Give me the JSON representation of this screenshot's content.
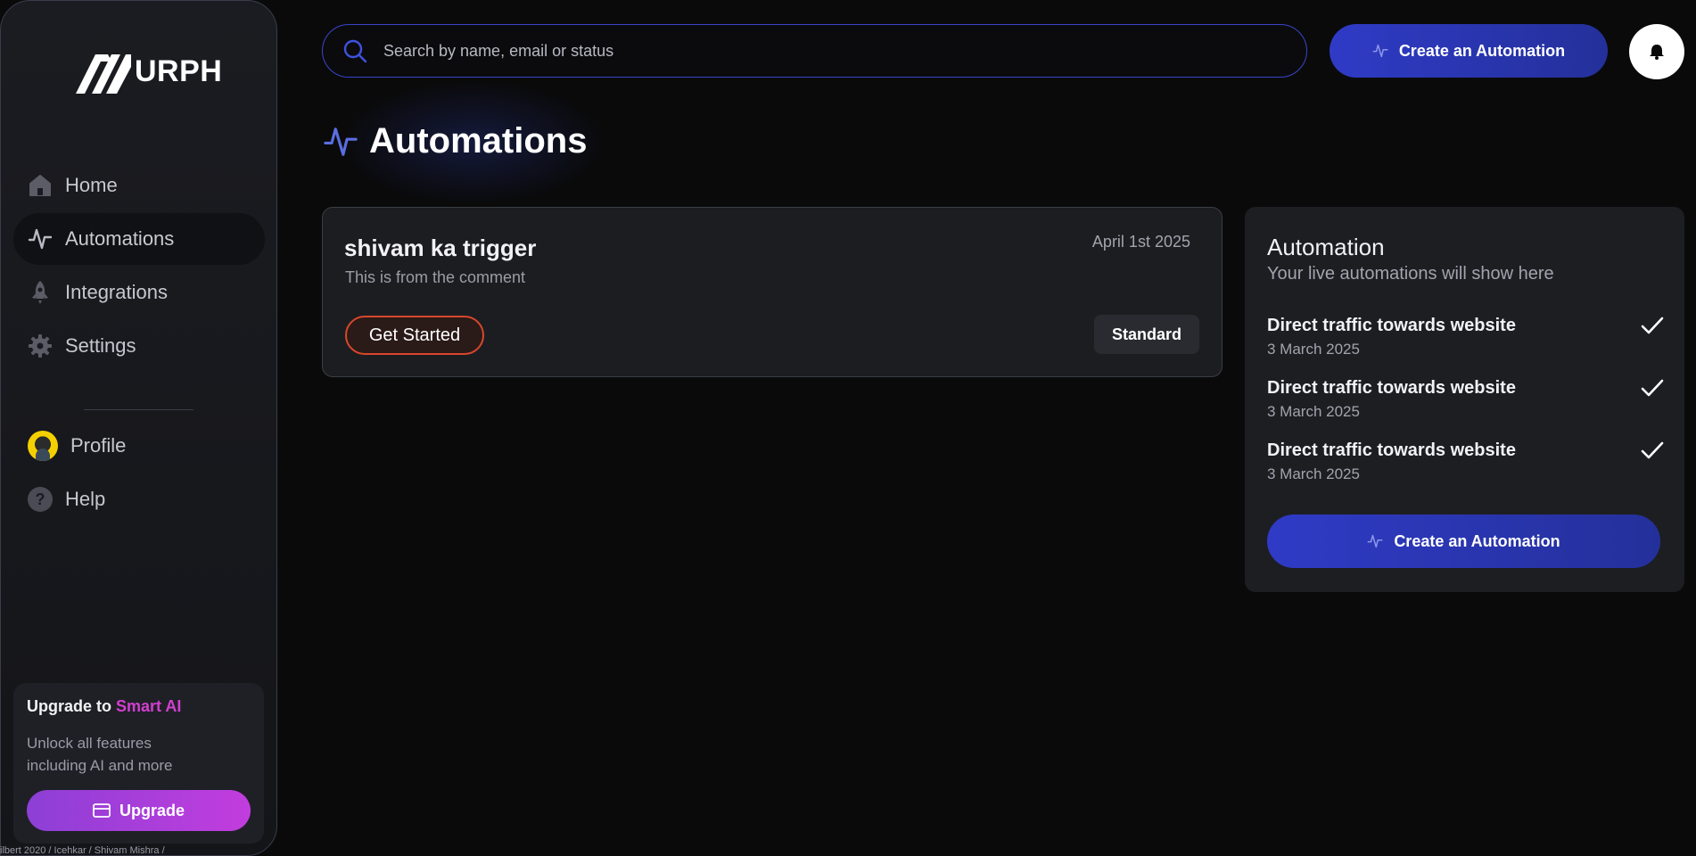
{
  "sidebar": {
    "logo_text": "URPH",
    "nav": [
      {
        "label": "Home",
        "icon": "home-icon"
      },
      {
        "label": "Automations",
        "icon": "pulse-icon"
      },
      {
        "label": "Integrations",
        "icon": "rocket-icon"
      },
      {
        "label": "Settings",
        "icon": "gear-icon"
      }
    ],
    "secondary_nav": [
      {
        "label": "Profile",
        "icon": "avatar"
      },
      {
        "label": "Help",
        "icon": "help-icon"
      }
    ],
    "upgrade": {
      "title_prefix": "Upgrade to ",
      "title_accent": "Smart AI",
      "description": "Unlock all features including AI and more",
      "button_label": "Upgrade"
    },
    "footer": "ilbert 2020 / Icehkar / Shivam Mishra /"
  },
  "topbar": {
    "search_placeholder": "Search by name, email or status",
    "create_button_label": "Create an Automation"
  },
  "page": {
    "title": "Automations"
  },
  "automation_card": {
    "name": "shivam ka trigger",
    "description": "This is from the comment",
    "date": "April 1st 2025",
    "action_label": "Get Started",
    "plan_badge": "Standard"
  },
  "live_panel": {
    "title": "Automation",
    "subtitle": "Your live automations will show here",
    "items": [
      {
        "title": "Direct traffic towards website",
        "date": "3 March 2025"
      },
      {
        "title": "Direct traffic towards website",
        "date": "3 March 2025"
      },
      {
        "title": "Direct traffic towards website",
        "date": "3 March 2025"
      }
    ],
    "create_button_label": "Create an Automation"
  },
  "colors": {
    "background": "#0a0a0b",
    "primary_button": "#2f3bc6",
    "accent_pink": "#d23fd0",
    "get_started_border": "#d8472c",
    "search_border": "#3a44c9"
  }
}
